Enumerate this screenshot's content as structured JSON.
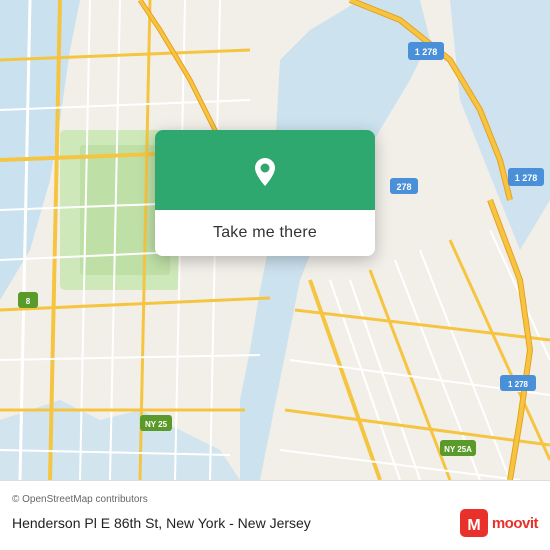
{
  "map": {
    "alt": "Map of New York - New Jersey area showing Henderson Pl E 86th St"
  },
  "card": {
    "button_label": "Take me there"
  },
  "bottom_bar": {
    "copyright": "© OpenStreetMap contributors",
    "location_name": "Henderson Pl E 86th St, New York - New Jersey"
  },
  "moovit": {
    "logo_text": "moovit"
  },
  "colors": {
    "card_green": "#2ea86e",
    "moovit_red": "#e8312a"
  }
}
